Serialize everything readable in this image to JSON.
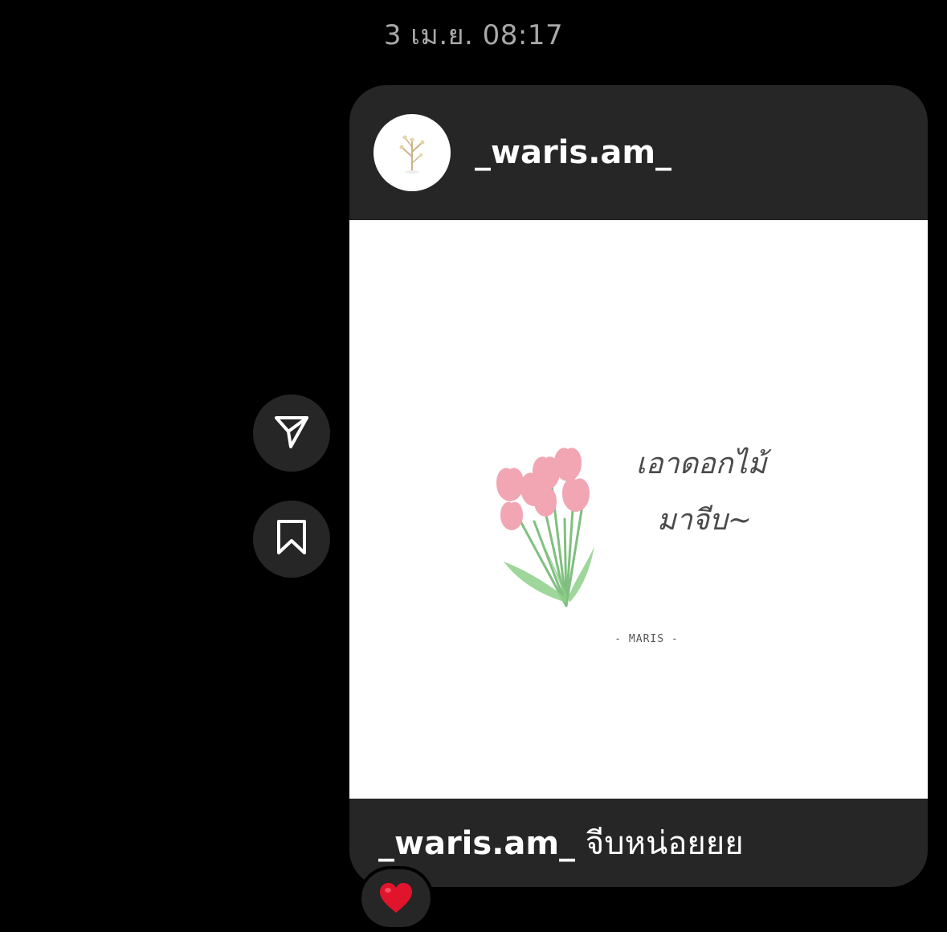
{
  "thread": {
    "timestamp": "3 เม.ย. 08:17"
  },
  "actions": {
    "share_icon": "paper-plane-icon",
    "save_icon": "bookmark-icon"
  },
  "post": {
    "username": "_waris.am_",
    "avatar_icon": "branch-illustration",
    "image": {
      "handwritten_line1": "เอาดอกไม้",
      "handwritten_line2": "มาจีบ~",
      "signature": "- MARIS -"
    },
    "caption_user": "_waris.am_",
    "caption_text": "จีบหน่อยยย"
  },
  "reaction": {
    "emoji": "heart",
    "color": "#e0142b"
  }
}
